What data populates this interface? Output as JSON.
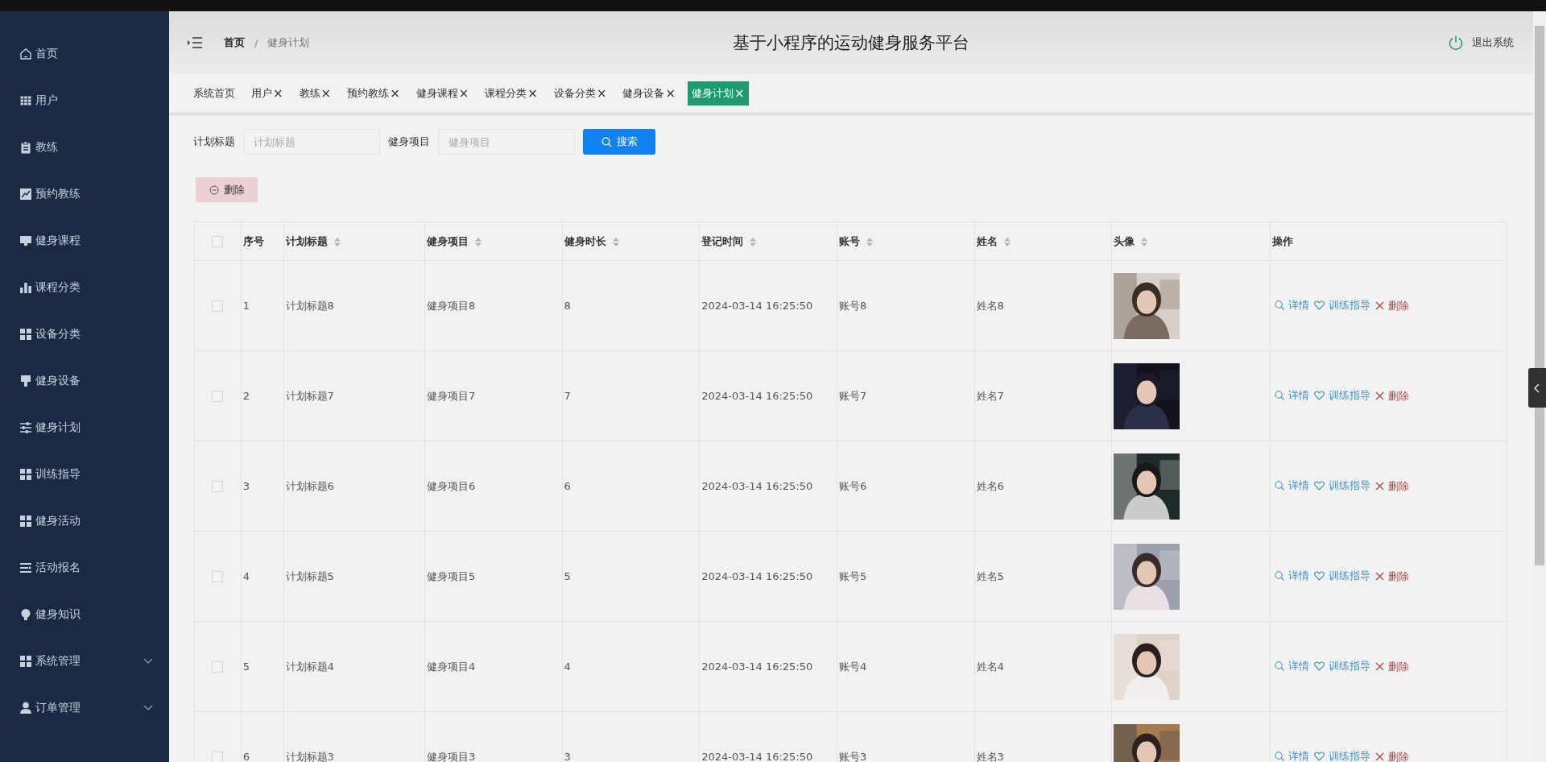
{
  "sidebar": {
    "items": [
      {
        "label": "首页",
        "kind": "link"
      },
      {
        "label": "用户",
        "kind": "link"
      },
      {
        "label": "教练",
        "kind": "link"
      },
      {
        "label": "预约教练",
        "kind": "link"
      },
      {
        "label": "健身课程",
        "kind": "link"
      },
      {
        "label": "课程分类",
        "kind": "link"
      },
      {
        "label": "设备分类",
        "kind": "link"
      },
      {
        "label": "健身设备",
        "kind": "link"
      },
      {
        "label": "健身计划",
        "kind": "link"
      },
      {
        "label": "训练指导",
        "kind": "link"
      },
      {
        "label": "健身活动",
        "kind": "link"
      },
      {
        "label": "活动报名",
        "kind": "link"
      },
      {
        "label": "健身知识",
        "kind": "link"
      },
      {
        "label": "系统管理",
        "kind": "submenu",
        "expanded": false
      },
      {
        "label": "订单管理",
        "kind": "submenu",
        "expanded": false
      }
    ]
  },
  "header": {
    "breadcrumb": [
      "首页",
      "健身计划"
    ],
    "breadcrumb_separator": "/",
    "title": "基于小程序的运动健身服务平台",
    "logout": "退出系统"
  },
  "tabs": [
    {
      "label": "系统首页",
      "closable": false,
      "selected": false
    },
    {
      "label": "用户",
      "closable": true,
      "selected": false
    },
    {
      "label": "教练",
      "closable": true,
      "selected": false
    },
    {
      "label": "预约教练",
      "closable": true,
      "selected": false
    },
    {
      "label": "健身课程",
      "closable": true,
      "selected": false
    },
    {
      "label": "课程分类",
      "closable": true,
      "selected": false
    },
    {
      "label": "设备分类",
      "closable": true,
      "selected": false
    },
    {
      "label": "健身设备",
      "closable": true,
      "selected": false
    },
    {
      "label": "健身计划",
      "closable": true,
      "selected": true
    }
  ],
  "close_mark": "×",
  "search": {
    "fields": [
      {
        "label": "计划标题",
        "placeholder": "计划标题"
      },
      {
        "label": "健身项目",
        "placeholder": "健身项目"
      }
    ],
    "button": "搜索"
  },
  "delete_button": "删除",
  "table": {
    "select_all": {
      "checked": false
    },
    "columns": [
      {
        "label": "序号",
        "sortable": false
      },
      {
        "label": "计划标题",
        "sortable": true
      },
      {
        "label": "健身项目",
        "sortable": true
      },
      {
        "label": "健身时长",
        "sortable": true
      },
      {
        "label": "登记时间",
        "sortable": true
      },
      {
        "label": "账号",
        "sortable": true
      },
      {
        "label": "姓名",
        "sortable": true
      },
      {
        "label": "头像",
        "sortable": true
      },
      {
        "label": "操作",
        "sortable": false
      }
    ],
    "rows": [
      {
        "checked": false,
        "cells": [
          "1",
          "计划标题8",
          "健身项目8",
          "8",
          "2024-03-14 16:25:50",
          "账号8",
          "姓名8"
        ],
        "actions": [
          "详情",
          "训练指导",
          "删除"
        ]
      },
      {
        "checked": false,
        "cells": [
          "2",
          "计划标题7",
          "健身项目7",
          "7",
          "2024-03-14 16:25:50",
          "账号7",
          "姓名7"
        ],
        "actions": [
          "详情",
          "训练指导",
          "删除"
        ]
      },
      {
        "checked": false,
        "cells": [
          "3",
          "计划标题6",
          "健身项目6",
          "6",
          "2024-03-14 16:25:50",
          "账号6",
          "姓名6"
        ],
        "actions": [
          "详情",
          "训练指导",
          "删除"
        ]
      },
      {
        "checked": false,
        "cells": [
          "4",
          "计划标题5",
          "健身项目5",
          "5",
          "2024-03-14 16:25:50",
          "账号5",
          "姓名5"
        ],
        "actions": [
          "详情",
          "训练指导",
          "删除"
        ]
      },
      {
        "checked": false,
        "cells": [
          "5",
          "计划标题4",
          "健身项目4",
          "4",
          "2024-03-14 16:25:50",
          "账号4",
          "姓名4"
        ],
        "actions": [
          "详情",
          "训练指导",
          "删除"
        ]
      },
      {
        "checked": false,
        "cells": [
          "6",
          "计划标题3",
          "健身项目3",
          "3",
          "2024-03-14 16:25:50",
          "账号3",
          "姓名3"
        ],
        "actions": [
          "详情",
          "训练指导",
          "删除"
        ]
      }
    ]
  }
}
